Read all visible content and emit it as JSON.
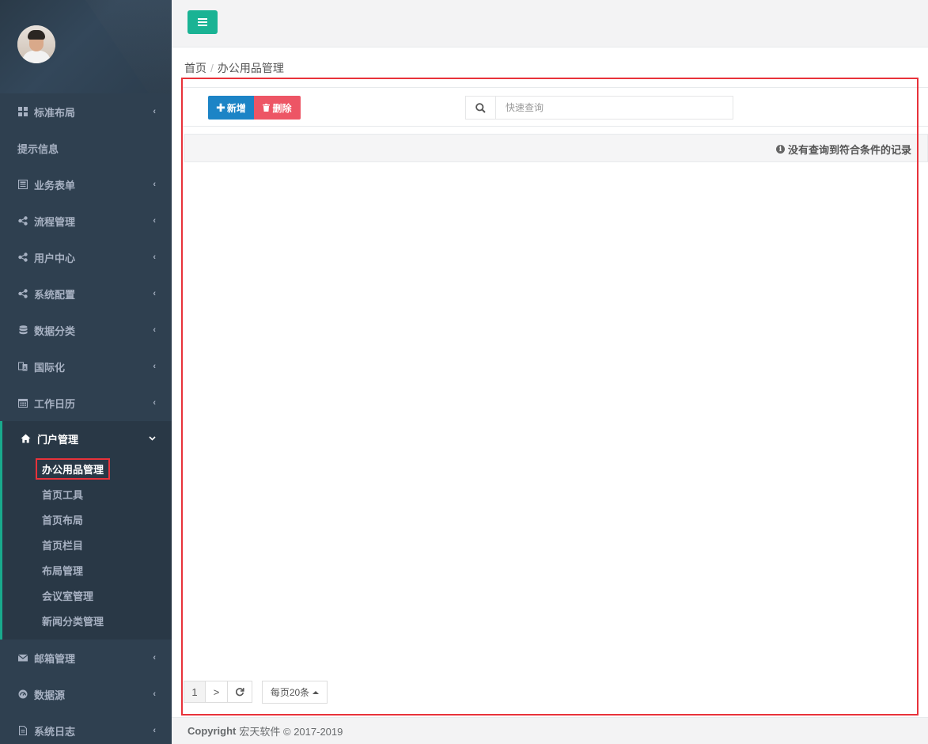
{
  "sidebar": {
    "items": [
      {
        "label": "标准布局",
        "icon": "grid-icon"
      },
      {
        "label": "提示信息",
        "icon": ""
      },
      {
        "label": "业务表单",
        "icon": "form-icon"
      },
      {
        "label": "流程管理",
        "icon": "share-icon"
      },
      {
        "label": "用户中心",
        "icon": "share-icon"
      },
      {
        "label": "系统配置",
        "icon": "share-icon"
      },
      {
        "label": "数据分类",
        "icon": "database-icon"
      },
      {
        "label": "国际化",
        "icon": "translate-icon"
      },
      {
        "label": "工作日历",
        "icon": "calendar-icon"
      }
    ],
    "active_group": {
      "label": "门户管理",
      "icon": "home-icon",
      "children": [
        "办公用品管理",
        "首页工具",
        "首页布局",
        "首页栏目",
        "布局管理",
        "会议室管理",
        "新闻分类管理"
      ]
    },
    "items_after": [
      {
        "label": "邮箱管理",
        "icon": "envelope-icon"
      },
      {
        "label": "数据源",
        "icon": "dashboard-icon"
      },
      {
        "label": "系统日志",
        "icon": "file-icon"
      }
    ]
  },
  "breadcrumb": {
    "home": "首页",
    "separator": "/",
    "current": "办公用品管理"
  },
  "toolbar": {
    "add_label": "新增",
    "delete_label": "删除",
    "search_placeholder": "快速查询"
  },
  "table": {
    "empty_message": "没有查询到符合条件的记录"
  },
  "pager": {
    "page": "1",
    "next": ">",
    "page_size": "每页20条"
  },
  "footer": {
    "copyright_label": "Copyright",
    "text": "宏天软件 © 2017-2019"
  },
  "colors": {
    "sidebar_bg": "#2f4050",
    "accent": "#1ab394",
    "primary": "#1c84c6",
    "danger": "#ed5565",
    "highlight_frame": "#e8323a"
  }
}
